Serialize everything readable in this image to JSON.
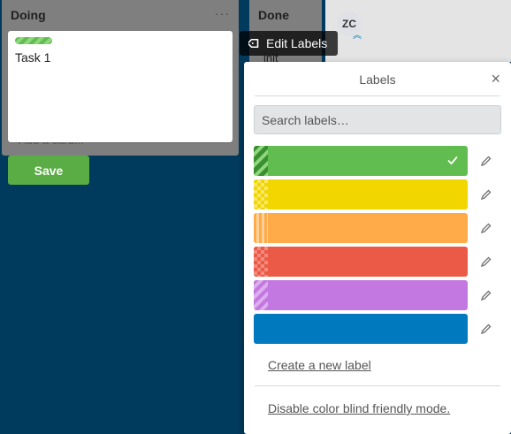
{
  "board": {
    "lists": [
      {
        "title": "Doing",
        "menu": "···",
        "add_card_hint": "Add a card..."
      },
      {
        "title": "Done",
        "card_text": "init"
      }
    ],
    "editing_card": {
      "title": "Task 1",
      "label_color": "#61bd4f",
      "save_label": "Save"
    }
  },
  "header": {
    "avatar_initials": "ZC"
  },
  "quick_action": {
    "edit_labels": "Edit Labels"
  },
  "labels_popover": {
    "title": "Labels",
    "close": "×",
    "search_placeholder": "Search labels…",
    "labels": [
      {
        "color": "#61bd4f",
        "selected": true,
        "pattern": "diagonal-stripes"
      },
      {
        "color": "#f2d600",
        "selected": false,
        "pattern": "checker"
      },
      {
        "color": "#ffab4a",
        "selected": false,
        "pattern": "vertical-bars"
      },
      {
        "color": "#eb5a46",
        "selected": false,
        "pattern": "checker"
      },
      {
        "color": "#c377e0",
        "selected": false,
        "pattern": "diagonal-stripes"
      },
      {
        "color": "#0079bf",
        "selected": false,
        "pattern": "none"
      }
    ],
    "create_label": "Create a new label",
    "colorblind_toggle": "Disable color blind friendly mode."
  }
}
